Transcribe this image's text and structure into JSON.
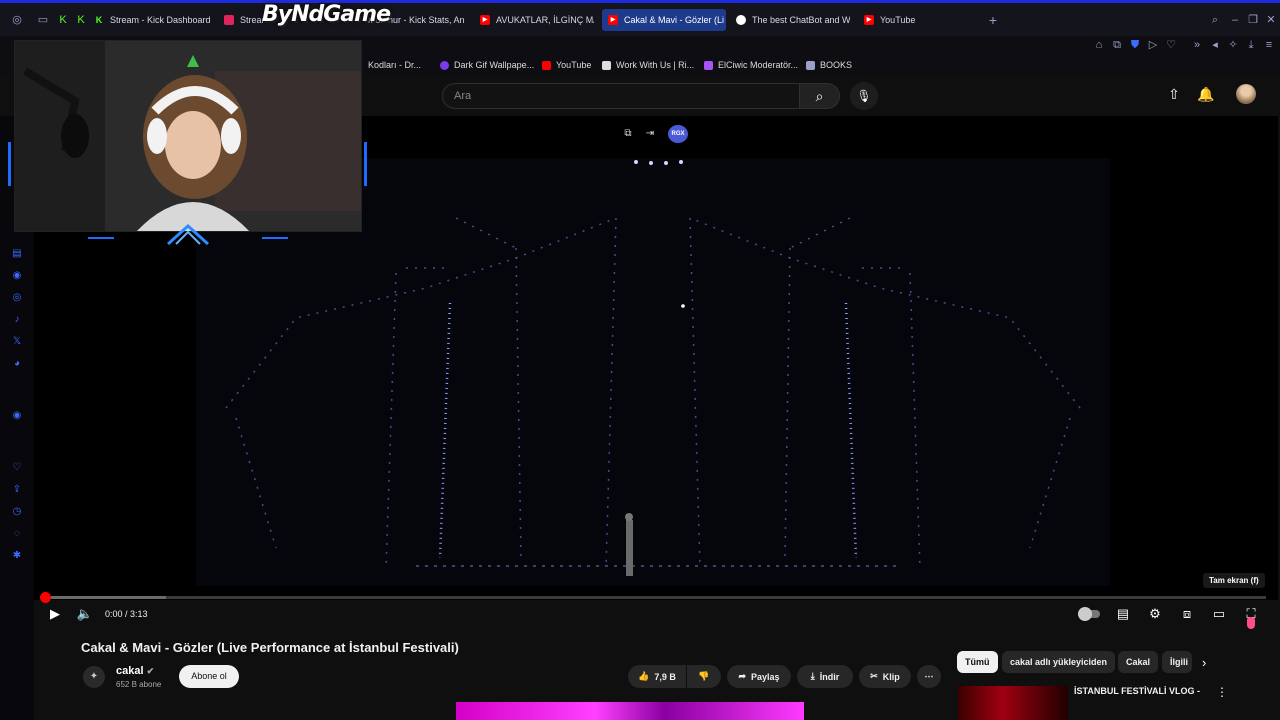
{
  "browser": {
    "tabs": [
      {
        "label": "Stream - Kick Dashboard",
        "icon": "kick-icon"
      },
      {
        "label": "Stream",
        "icon": "stream-icon"
      },
      {
        "label": "morfinur - Kick Stats, An",
        "icon": "stats-icon"
      },
      {
        "label": "AVUKATLAR, İLGİNÇ MA",
        "icon": "youtube-icon"
      },
      {
        "label": "Cakal & Mavi - Gözler (Li",
        "icon": "youtube-icon",
        "active": true
      },
      {
        "label": "The best ChatBot and W",
        "icon": "chatbot-icon"
      },
      {
        "label": "YouTube",
        "icon": "youtube-icon"
      }
    ],
    "new_tab_label": "+"
  },
  "bookmarks": [
    {
      "label": "Kodları - Dr...",
      "icon": "bookmark-icon"
    },
    {
      "label": "Dark Gif Wallpape...",
      "icon": "gif-icon"
    },
    {
      "label": "YouTube",
      "icon": "youtube-icon"
    },
    {
      "label": "Work With Us | Ri...",
      "icon": "riot-icon"
    },
    {
      "label": "ElCiwic Moderatör...",
      "icon": "moderator-icon"
    },
    {
      "label": "BOOKS",
      "icon": "books-icon"
    }
  ],
  "youtube": {
    "search_placeholder": "Ara"
  },
  "overlay": {
    "logo_text": "ByNdGame",
    "rgx_label": "RGX"
  },
  "player": {
    "time": "0:00 / 3:13",
    "progress_fraction": 0.0,
    "buffered_fraction": 0.1,
    "tooltip": "Tam ekran (f)"
  },
  "video": {
    "title": "Cakal & Mavi - Gözler (Live Performance at İstanbul Festivali)",
    "channel": "cakal",
    "subscribers": "652 B abone",
    "subscribe_label": "Abone ol",
    "likes": "7,9 B",
    "share_label": "Paylaş",
    "download_label": "İndir",
    "clip_label": "Klip"
  },
  "sidebar_chips": [
    "Tümü",
    "cakal adlı yükleyiciden",
    "Cakal",
    "İlgili"
  ],
  "recommended": {
    "title": "İSTANBUL FESTİVALİ VLOG -"
  },
  "colors": {
    "accent": "#1d2be0",
    "youtube_red": "#ff0000",
    "kick_green": "#53fc18"
  }
}
